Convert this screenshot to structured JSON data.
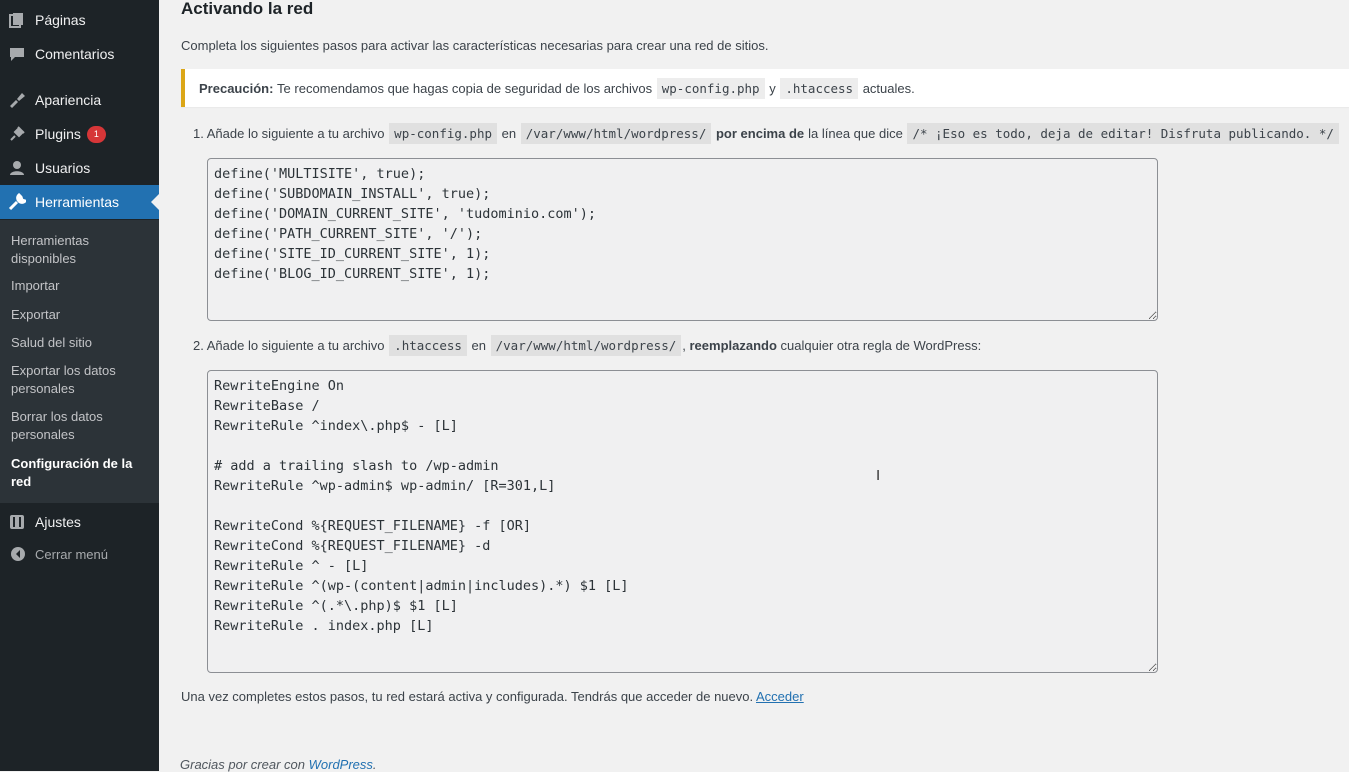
{
  "sidebar": {
    "items": [
      {
        "label": "Páginas",
        "icon": "pages-icon"
      },
      {
        "label": "Comentarios",
        "icon": "comments-icon"
      },
      {
        "label": "Apariencia",
        "icon": "appearance-icon"
      },
      {
        "label": "Plugins",
        "icon": "plugins-icon",
        "badge": "1"
      },
      {
        "label": "Usuarios",
        "icon": "users-icon"
      },
      {
        "label": "Herramientas",
        "icon": "tools-icon",
        "current": true
      },
      {
        "label": "Ajustes",
        "icon": "settings-icon"
      }
    ],
    "submenu": [
      "Herramientas disponibles",
      "Importar",
      "Exportar",
      "Salud del sitio",
      "Exportar los datos personales",
      "Borrar los datos personales",
      "Configuración de la red"
    ],
    "collapse_label": "Cerrar menú"
  },
  "main": {
    "title": "Activando la red",
    "intro": "Completa los siguientes pasos para activar las características necesarias para crear una red de sitios.",
    "notice": {
      "strong": "Precaución:",
      "text1": "Te recomendamos que hagas copia de seguridad de los archivos",
      "code1": "wp-config.php",
      "text2": "y",
      "code2": ".htaccess",
      "text3": "actuales."
    },
    "step1": {
      "num": "1.",
      "text1": "Añade lo siguiente a tu archivo",
      "code1": "wp-config.php",
      "text2": "en",
      "code2": "/var/www/html/wordpress/",
      "strong": "por encima de",
      "text3": "la línea que dice",
      "code3": "/* ¡Eso es todo, deja de editar! Disfruta publicando. */",
      "content": "define('MULTISITE', true);\ndefine('SUBDOMAIN_INSTALL', true);\ndefine('DOMAIN_CURRENT_SITE', 'tudominio.com');\ndefine('PATH_CURRENT_SITE', '/');\ndefine('SITE_ID_CURRENT_SITE', 1);\ndefine('BLOG_ID_CURRENT_SITE', 1);"
    },
    "step2": {
      "num": "2.",
      "text1": "Añade lo siguiente a tu archivo",
      "code1": ".htaccess",
      "text2": "en",
      "code2": "/var/www/html/wordpress/",
      "text_comma": ",",
      "strong": "reemplazando",
      "text3": "cualquier otra regla de WordPress:",
      "content": "RewriteEngine On\nRewriteBase /\nRewriteRule ^index\\.php$ - [L]\n\n# add a trailing slash to /wp-admin\nRewriteRule ^wp-admin$ wp-admin/ [R=301,L]\n\nRewriteCond %{REQUEST_FILENAME} -f [OR]\nRewriteCond %{REQUEST_FILENAME} -d\nRewriteRule ^ - [L]\nRewriteRule ^(wp-(content|admin|includes).*) $1 [L]\nRewriteRule ^(.*\\.php)$ $1 [L]\nRewriteRule . index.php [L]"
    },
    "outro": "Una vez completes estos pasos, tu red estará activa y configurada. Tendrás que acceder de nuevo.",
    "login_link": "Acceder",
    "footer_text": "Gracias por crear con",
    "footer_link": "WordPress",
    "footer_end": "."
  },
  "colors": {
    "sidebar_bg": "#1d2327",
    "submenu_bg": "#2c3338",
    "accent": "#2271b1",
    "warning": "#dba617",
    "badge": "#d63638"
  }
}
